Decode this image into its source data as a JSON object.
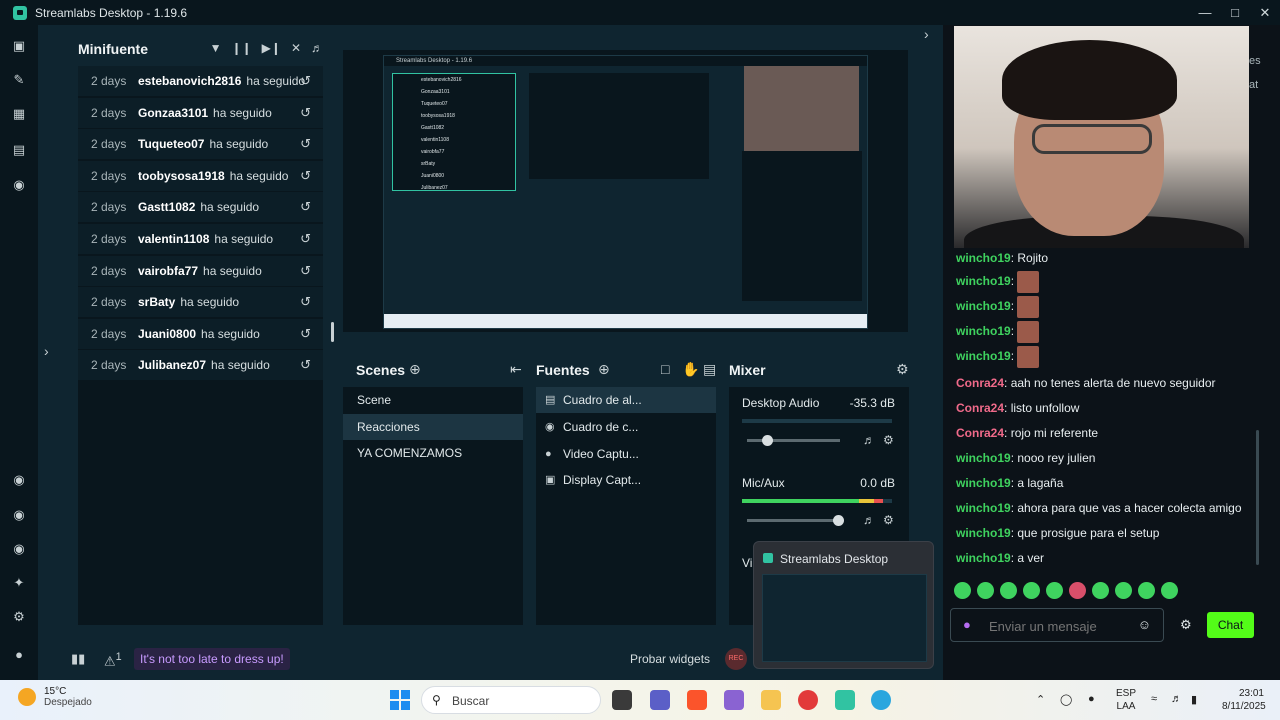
{
  "app": {
    "title": "Streamlabs Desktop - 1.19.6"
  },
  "events": {
    "title": "Minifuente",
    "items": [
      {
        "age": "2 days",
        "user": "estebanovich2816",
        "action": "ha seguido"
      },
      {
        "age": "2 days",
        "user": "Gonzaa3101",
        "action": "ha seguido"
      },
      {
        "age": "2 days",
        "user": "Tuqueteo07",
        "action": "ha seguido"
      },
      {
        "age": "2 days",
        "user": "toobysosa1918",
        "action": "ha seguido"
      },
      {
        "age": "2 days",
        "user": "Gastt1082",
        "action": "ha seguido"
      },
      {
        "age": "2 days",
        "user": "valentin1108",
        "action": "ha seguido"
      },
      {
        "age": "2 days",
        "user": "vairobfa77",
        "action": "ha seguido"
      },
      {
        "age": "2 days",
        "user": "srBaty",
        "action": "ha seguido"
      },
      {
        "age": "2 days",
        "user": "Juani0800",
        "action": "ha seguido"
      },
      {
        "age": "2 days",
        "user": "Julibanez07",
        "action": "ha seguido"
      }
    ]
  },
  "scenes": {
    "title": "Scenes",
    "items": [
      "Scene",
      "Reacciones",
      "YA COMENZAMOS"
    ],
    "active_index": 1
  },
  "sources": {
    "title": "Fuentes",
    "items": [
      {
        "label": "Cuadro de al...",
        "icon": "window-icon"
      },
      {
        "label": "Cuadro de c...",
        "icon": "chat-icon"
      },
      {
        "label": "Video Captu...",
        "icon": "camera-icon"
      },
      {
        "label": "Display Capt...",
        "icon": "monitor-icon"
      }
    ]
  },
  "mixer": {
    "title": "Mixer",
    "channels": [
      {
        "name": "Desktop Audio",
        "db": "-35.3 dB",
        "volume": 0.22
      },
      {
        "name": "Mic/Aux",
        "db": "0.0 dB",
        "volume": 0.98
      }
    ],
    "cut_label": "Vi"
  },
  "bottombar": {
    "alert_count": "1",
    "promo": "It's not too late to dress up!",
    "test_widgets": "Probar widgets",
    "rec": "REC"
  },
  "thumbnail": {
    "title": "Streamlabs Desktop"
  },
  "chat": {
    "side_text_1": "es",
    "side_text_2": "at",
    "messages": [
      {
        "nick": "wincho19",
        "text": "Rojito",
        "color": "#3fd35f",
        "emote": false
      },
      {
        "nick": "wincho19",
        "text": "",
        "color": "#3fd35f",
        "emote": true
      },
      {
        "nick": "wincho19",
        "text": "",
        "color": "#3fd35f",
        "emote": true
      },
      {
        "nick": "wincho19",
        "text": "",
        "color": "#3fd35f",
        "emote": true
      },
      {
        "nick": "wincho19",
        "text": "",
        "color": "#3fd35f",
        "emote": true
      },
      {
        "nick": "Conra24",
        "text": "aah no tenes alerta de nuevo seguidor",
        "color": "#f06a8a",
        "emote": false
      },
      {
        "nick": "Conra24",
        "text": "listo unfollow",
        "color": "#f06a8a",
        "emote": false
      },
      {
        "nick": "Conra24",
        "text": "rojo mi referente",
        "color": "#f06a8a",
        "emote": false
      },
      {
        "nick": "wincho19",
        "text": "nooo rey julien",
        "color": "#3fd35f",
        "emote": false
      },
      {
        "nick": "wincho19",
        "text": "a lagaña",
        "color": "#3fd35f",
        "emote": false
      },
      {
        "nick": "wincho19",
        "text": "ahora para que vas a hacer colecta amigo",
        "color": "#3fd35f",
        "emote": false
      },
      {
        "nick": "wincho19",
        "text": "que prosigue para el setup",
        "color": "#3fd35f",
        "emote": false
      },
      {
        "nick": "wincho19",
        "text": "a ver",
        "color": "#3fd35f",
        "emote": false
      }
    ],
    "input_placeholder": "Enviar un mensaje",
    "send_label": "Chat"
  },
  "taskbar": {
    "temp": "15°C",
    "weather": "Despejado",
    "search": "Buscar",
    "lang1": "ESP",
    "lang2": "LAA",
    "time": "23:01",
    "date": "8/11/2025"
  },
  "colors": {
    "accent": "#31c3a2",
    "chat_button": "#53fc18",
    "promo": "#c89bff"
  }
}
